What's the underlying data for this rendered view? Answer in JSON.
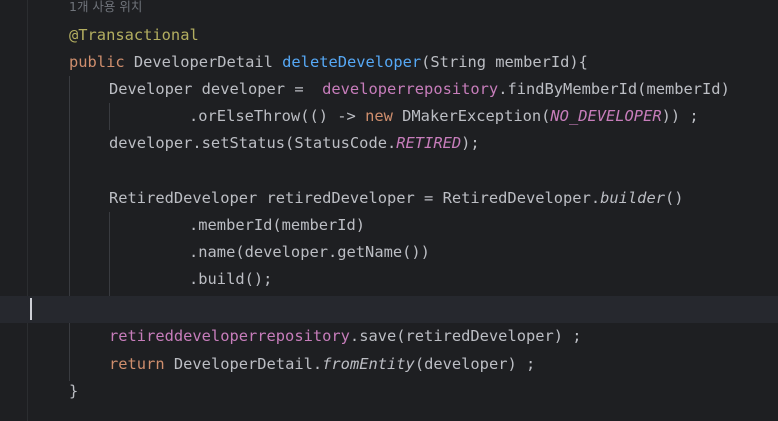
{
  "editor": {
    "usage_hint": "1개 사용 위치",
    "annotation": "@Transactional",
    "l2": {
      "kw_public": "public",
      "ret_type": " DeveloperDetail ",
      "method_name": "deleteDeveloper",
      "params": "(String memberId){"
    },
    "l3": {
      "decl": "Developer developer =  ",
      "repo": "developerrepository",
      "call": ".findByMemberId(memberId)"
    },
    "l4": {
      "pre": ".orElseThrow(() -> ",
      "kw_new": "new",
      "ctor": " DMakerException(",
      "const": "NO_DEVELOPER",
      "post": ")) ;"
    },
    "l5": {
      "pre": "developer.setStatus(StatusCode.",
      "const": "RETIRED",
      "post": ");"
    },
    "l7": {
      "pre": "RetiredDeveloper retiredDeveloper = RetiredDeveloper.",
      "method": "builder",
      "post": "()"
    },
    "l8": ".memberId(memberId)",
    "l9": ".name(developer.getName())",
    "l10": ".build();",
    "l12": {
      "repo": "retireddeveloperrepository",
      "post": ".save(retiredDeveloper) ;"
    },
    "l13": {
      "kw_return": "return",
      "mid": " DeveloperDetail.",
      "method": "fromEntity",
      "post": "(developer) ;"
    },
    "l14": "}"
  },
  "colors": {
    "background": "#1e1f22",
    "text": "#bcbec4",
    "keyword": "#cf8e6d",
    "annotation": "#b3ae60",
    "method_declaration": "#56a8f5",
    "field": "#c77dbb",
    "comment_hint": "#6f737a",
    "current_line": "#26282e"
  }
}
